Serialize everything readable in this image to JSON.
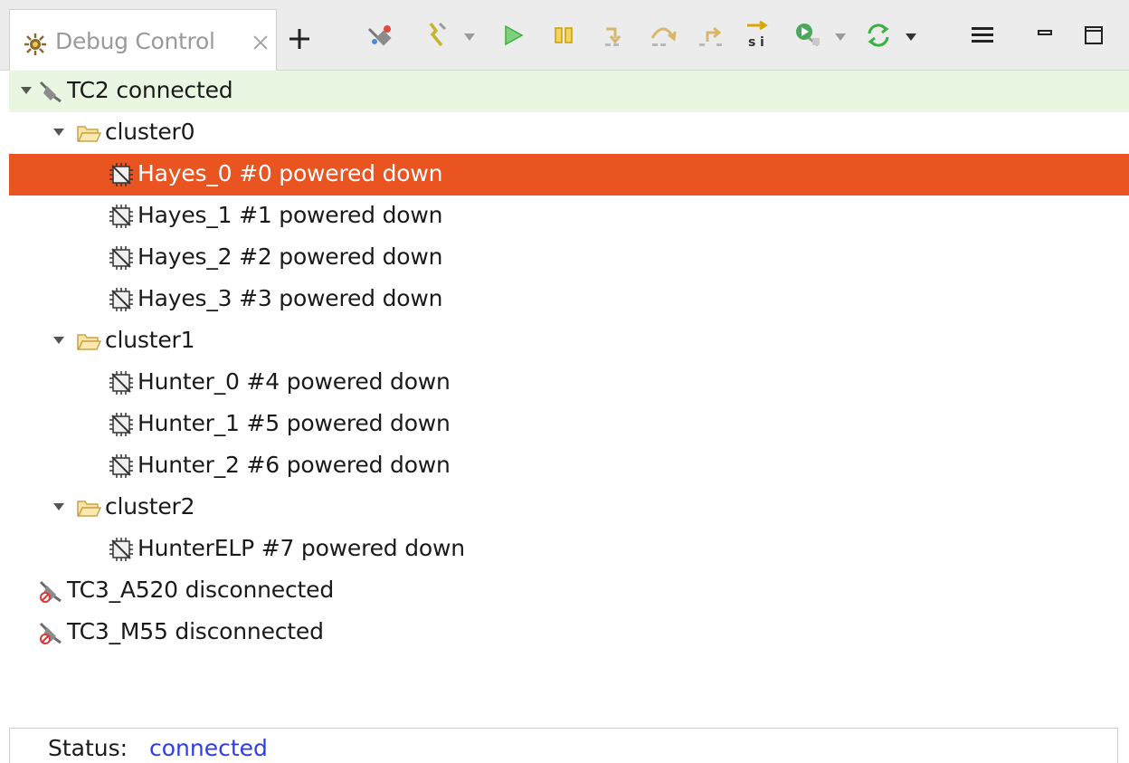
{
  "view": {
    "tab_title": "Debug Control",
    "tab_icon": "bug-gear-icon"
  },
  "toolbar": {
    "icons": [
      "connect-target-icon",
      "disconnect-target-icon",
      "run-icon",
      "suspend-icon",
      "step-into-icon",
      "step-over-icon",
      "step-return-icon",
      "step-instruction-icon",
      "debug-from-icon",
      "sync-icon",
      "view-menu-icon",
      "minimize-icon",
      "maximize-icon"
    ]
  },
  "tree": {
    "connections": [
      {
        "label": "TC2 connected",
        "state": "connected",
        "clusters": [
          {
            "label": "cluster0",
            "cores": [
              {
                "label": "Hayes_0 #0 powered down",
                "selected": true
              },
              {
                "label": "Hayes_1 #1 powered down"
              },
              {
                "label": "Hayes_2 #2 powered down"
              },
              {
                "label": "Hayes_3 #3 powered down"
              }
            ]
          },
          {
            "label": "cluster1",
            "cores": [
              {
                "label": "Hunter_0 #4 powered down"
              },
              {
                "label": "Hunter_1 #5 powered down"
              },
              {
                "label": "Hunter_2 #6 powered down"
              }
            ]
          },
          {
            "label": "cluster2",
            "cores": [
              {
                "label": "HunterELP #7 powered down"
              }
            ]
          }
        ]
      },
      {
        "label": "TC3_A520 disconnected",
        "state": "disconnected"
      },
      {
        "label": "TC3_M55 disconnected",
        "state": "disconnected"
      }
    ]
  },
  "status": {
    "label": "Status:",
    "value": "connected"
  },
  "colors": {
    "selection": "#e95420",
    "connected_row": "#e9f7e2",
    "status_value": "#2c3ee6",
    "run_green": "#3cb043",
    "suspend_yellow": "#e6b800"
  }
}
